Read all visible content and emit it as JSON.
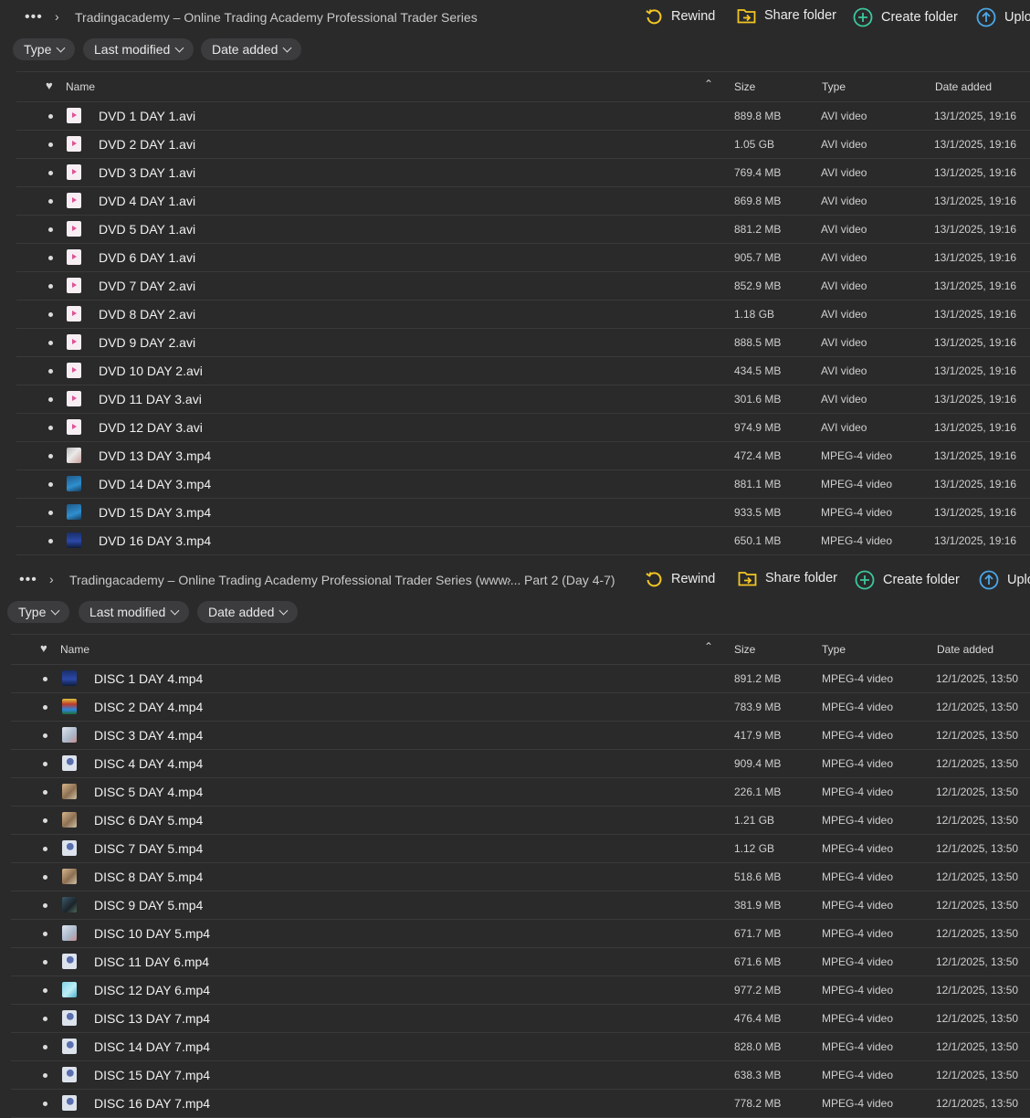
{
  "panel1": {
    "more_label": "•••",
    "crumbs": [
      "Tradingacademy – Online Trading Academy Professional Trader Series"
    ],
    "actions": {
      "rewind": "Rewind",
      "share": "Share folder",
      "create": "Create folder",
      "upload": "Uplo"
    },
    "filters": [
      "Type",
      "Last modified",
      "Date added"
    ],
    "columns": {
      "name": "Name",
      "size": "Size",
      "type": "Type",
      "date": "Date added"
    },
    "files": [
      {
        "name": "DVD 1 DAY 1.avi",
        "size": "889.8 MB",
        "type": "AVI video",
        "date": "13/1/2025, 19:16",
        "icon": "avi"
      },
      {
        "name": "DVD 2 DAY 1.avi",
        "size": "1.05 GB",
        "type": "AVI video",
        "date": "13/1/2025, 19:16",
        "icon": "avi"
      },
      {
        "name": "DVD 3 DAY 1.avi",
        "size": "769.4 MB",
        "type": "AVI video",
        "date": "13/1/2025, 19:16",
        "icon": "avi"
      },
      {
        "name": "DVD 4 DAY 1.avi",
        "size": "869.8 MB",
        "type": "AVI video",
        "date": "13/1/2025, 19:16",
        "icon": "avi"
      },
      {
        "name": "DVD 5 DAY 1.avi",
        "size": "881.2 MB",
        "type": "AVI video",
        "date": "13/1/2025, 19:16",
        "icon": "avi"
      },
      {
        "name": "DVD 6 DAY 1.avi",
        "size": "905.7 MB",
        "type": "AVI video",
        "date": "13/1/2025, 19:16",
        "icon": "avi"
      },
      {
        "name": "DVD 7 DAY 2.avi",
        "size": "852.9 MB",
        "type": "AVI video",
        "date": "13/1/2025, 19:16",
        "icon": "avi"
      },
      {
        "name": "DVD 8 DAY 2.avi",
        "size": "1.18 GB",
        "type": "AVI video",
        "date": "13/1/2025, 19:16",
        "icon": "avi"
      },
      {
        "name": "DVD 9 DAY 2.avi",
        "size": "888.5 MB",
        "type": "AVI video",
        "date": "13/1/2025, 19:16",
        "icon": "avi"
      },
      {
        "name": "DVD 10 DAY 2.avi",
        "size": "434.5 MB",
        "type": "AVI video",
        "date": "13/1/2025, 19:16",
        "icon": "avi"
      },
      {
        "name": "DVD 11 DAY 3.avi",
        "size": "301.6 MB",
        "type": "AVI video",
        "date": "13/1/2025, 19:16",
        "icon": "avi"
      },
      {
        "name": "DVD 12 DAY 3.avi",
        "size": "974.9 MB",
        "type": "AVI video",
        "date": "13/1/2025, 19:16",
        "icon": "avi"
      },
      {
        "name": "DVD 13 DAY 3.mp4",
        "size": "472.4 MB",
        "type": "MPEG-4 video",
        "date": "13/1/2025, 19:16",
        "icon": "thumb-grey"
      },
      {
        "name": "DVD 14 DAY 3.mp4",
        "size": "881.1 MB",
        "type": "MPEG-4 video",
        "date": "13/1/2025, 19:16",
        "icon": "thumb-blue"
      },
      {
        "name": "DVD 15 DAY 3.mp4",
        "size": "933.5 MB",
        "type": "MPEG-4 video",
        "date": "13/1/2025, 19:16",
        "icon": "thumb-blue"
      },
      {
        "name": "DVD 16 DAY 3.mp4",
        "size": "650.1 MB",
        "type": "MPEG-4 video",
        "date": "13/1/2025, 19:16",
        "icon": "thumb-navy"
      }
    ]
  },
  "panel2": {
    "more_label": "•••",
    "crumbs": [
      "Tradingacademy – Online Trading Academy Professional Trader Series (www....",
      "Part 2 (Day 4-7)"
    ],
    "actions": {
      "rewind": "Rewind",
      "share": "Share folder",
      "create": "Create folder",
      "upload": "Uplo"
    },
    "filters": [
      "Type",
      "Last modified",
      "Date added"
    ],
    "columns": {
      "name": "Name",
      "size": "Size",
      "type": "Type",
      "date": "Date added"
    },
    "files": [
      {
        "name": "DISC 1 DAY 4.mp4",
        "size": "891.2 MB",
        "type": "MPEG-4 video",
        "date": "12/1/2025, 13:50",
        "icon": "thumb-navy"
      },
      {
        "name": "DISC 2 DAY 4.mp4",
        "size": "783.9 MB",
        "type": "MPEG-4 video",
        "date": "12/1/2025, 13:50",
        "icon": "thumb-multi"
      },
      {
        "name": "DISC 3 DAY 4.mp4",
        "size": "417.9 MB",
        "type": "MPEG-4 video",
        "date": "12/1/2025, 13:50",
        "icon": "thumb-light"
      },
      {
        "name": "DISC 4 DAY 4.mp4",
        "size": "909.4 MB",
        "type": "MPEG-4 video",
        "date": "12/1/2025, 13:50",
        "icon": "thumb-person"
      },
      {
        "name": "DISC 5 DAY 4.mp4",
        "size": "226.1 MB",
        "type": "MPEG-4 video",
        "date": "12/1/2025, 13:50",
        "icon": "thumb-warm"
      },
      {
        "name": "DISC 6 DAY 5.mp4",
        "size": "1.21 GB",
        "type": "MPEG-4 video",
        "date": "12/1/2025, 13:50",
        "icon": "thumb-warm"
      },
      {
        "name": "DISC 7 DAY 5.mp4",
        "size": "1.12 GB",
        "type": "MPEG-4 video",
        "date": "12/1/2025, 13:50",
        "icon": "thumb-person"
      },
      {
        "name": "DISC 8 DAY 5.mp4",
        "size": "518.6 MB",
        "type": "MPEG-4 video",
        "date": "12/1/2025, 13:50",
        "icon": "thumb-warm"
      },
      {
        "name": "DISC 9 DAY 5.mp4",
        "size": "381.9 MB",
        "type": "MPEG-4 video",
        "date": "12/1/2025, 13:50",
        "icon": "thumb-dark"
      },
      {
        "name": "DISC 10 DAY 5.mp4",
        "size": "671.7 MB",
        "type": "MPEG-4 video",
        "date": "12/1/2025, 13:50",
        "icon": "thumb-light"
      },
      {
        "name": "DISC 11 DAY 6.mp4",
        "size": "671.6 MB",
        "type": "MPEG-4 video",
        "date": "12/1/2025, 13:50",
        "icon": "thumb-person"
      },
      {
        "name": "DISC 12 DAY 6.mp4",
        "size": "977.2 MB",
        "type": "MPEG-4 video",
        "date": "12/1/2025, 13:50",
        "icon": "thumb-cyan"
      },
      {
        "name": "DISC 13 DAY 7.mp4",
        "size": "476.4 MB",
        "type": "MPEG-4 video",
        "date": "12/1/2025, 13:50",
        "icon": "thumb-person"
      },
      {
        "name": "DISC 14 DAY 7.mp4",
        "size": "828.0 MB",
        "type": "MPEG-4 video",
        "date": "12/1/2025, 13:50",
        "icon": "thumb-person"
      },
      {
        "name": "DISC 15 DAY 7.mp4",
        "size": "638.3 MB",
        "type": "MPEG-4 video",
        "date": "12/1/2025, 13:50",
        "icon": "thumb-person"
      },
      {
        "name": "DISC 16 DAY 7.mp4",
        "size": "778.2 MB",
        "type": "MPEG-4 video",
        "date": "12/1/2025, 13:50",
        "icon": "thumb-person"
      }
    ]
  },
  "colors": {
    "background": "#2a2a2b",
    "accent_yellow": "#f3c623",
    "accent_green": "#3cc79a",
    "accent_blue": "#4aa8e8",
    "avi_icon": "#e05297"
  }
}
